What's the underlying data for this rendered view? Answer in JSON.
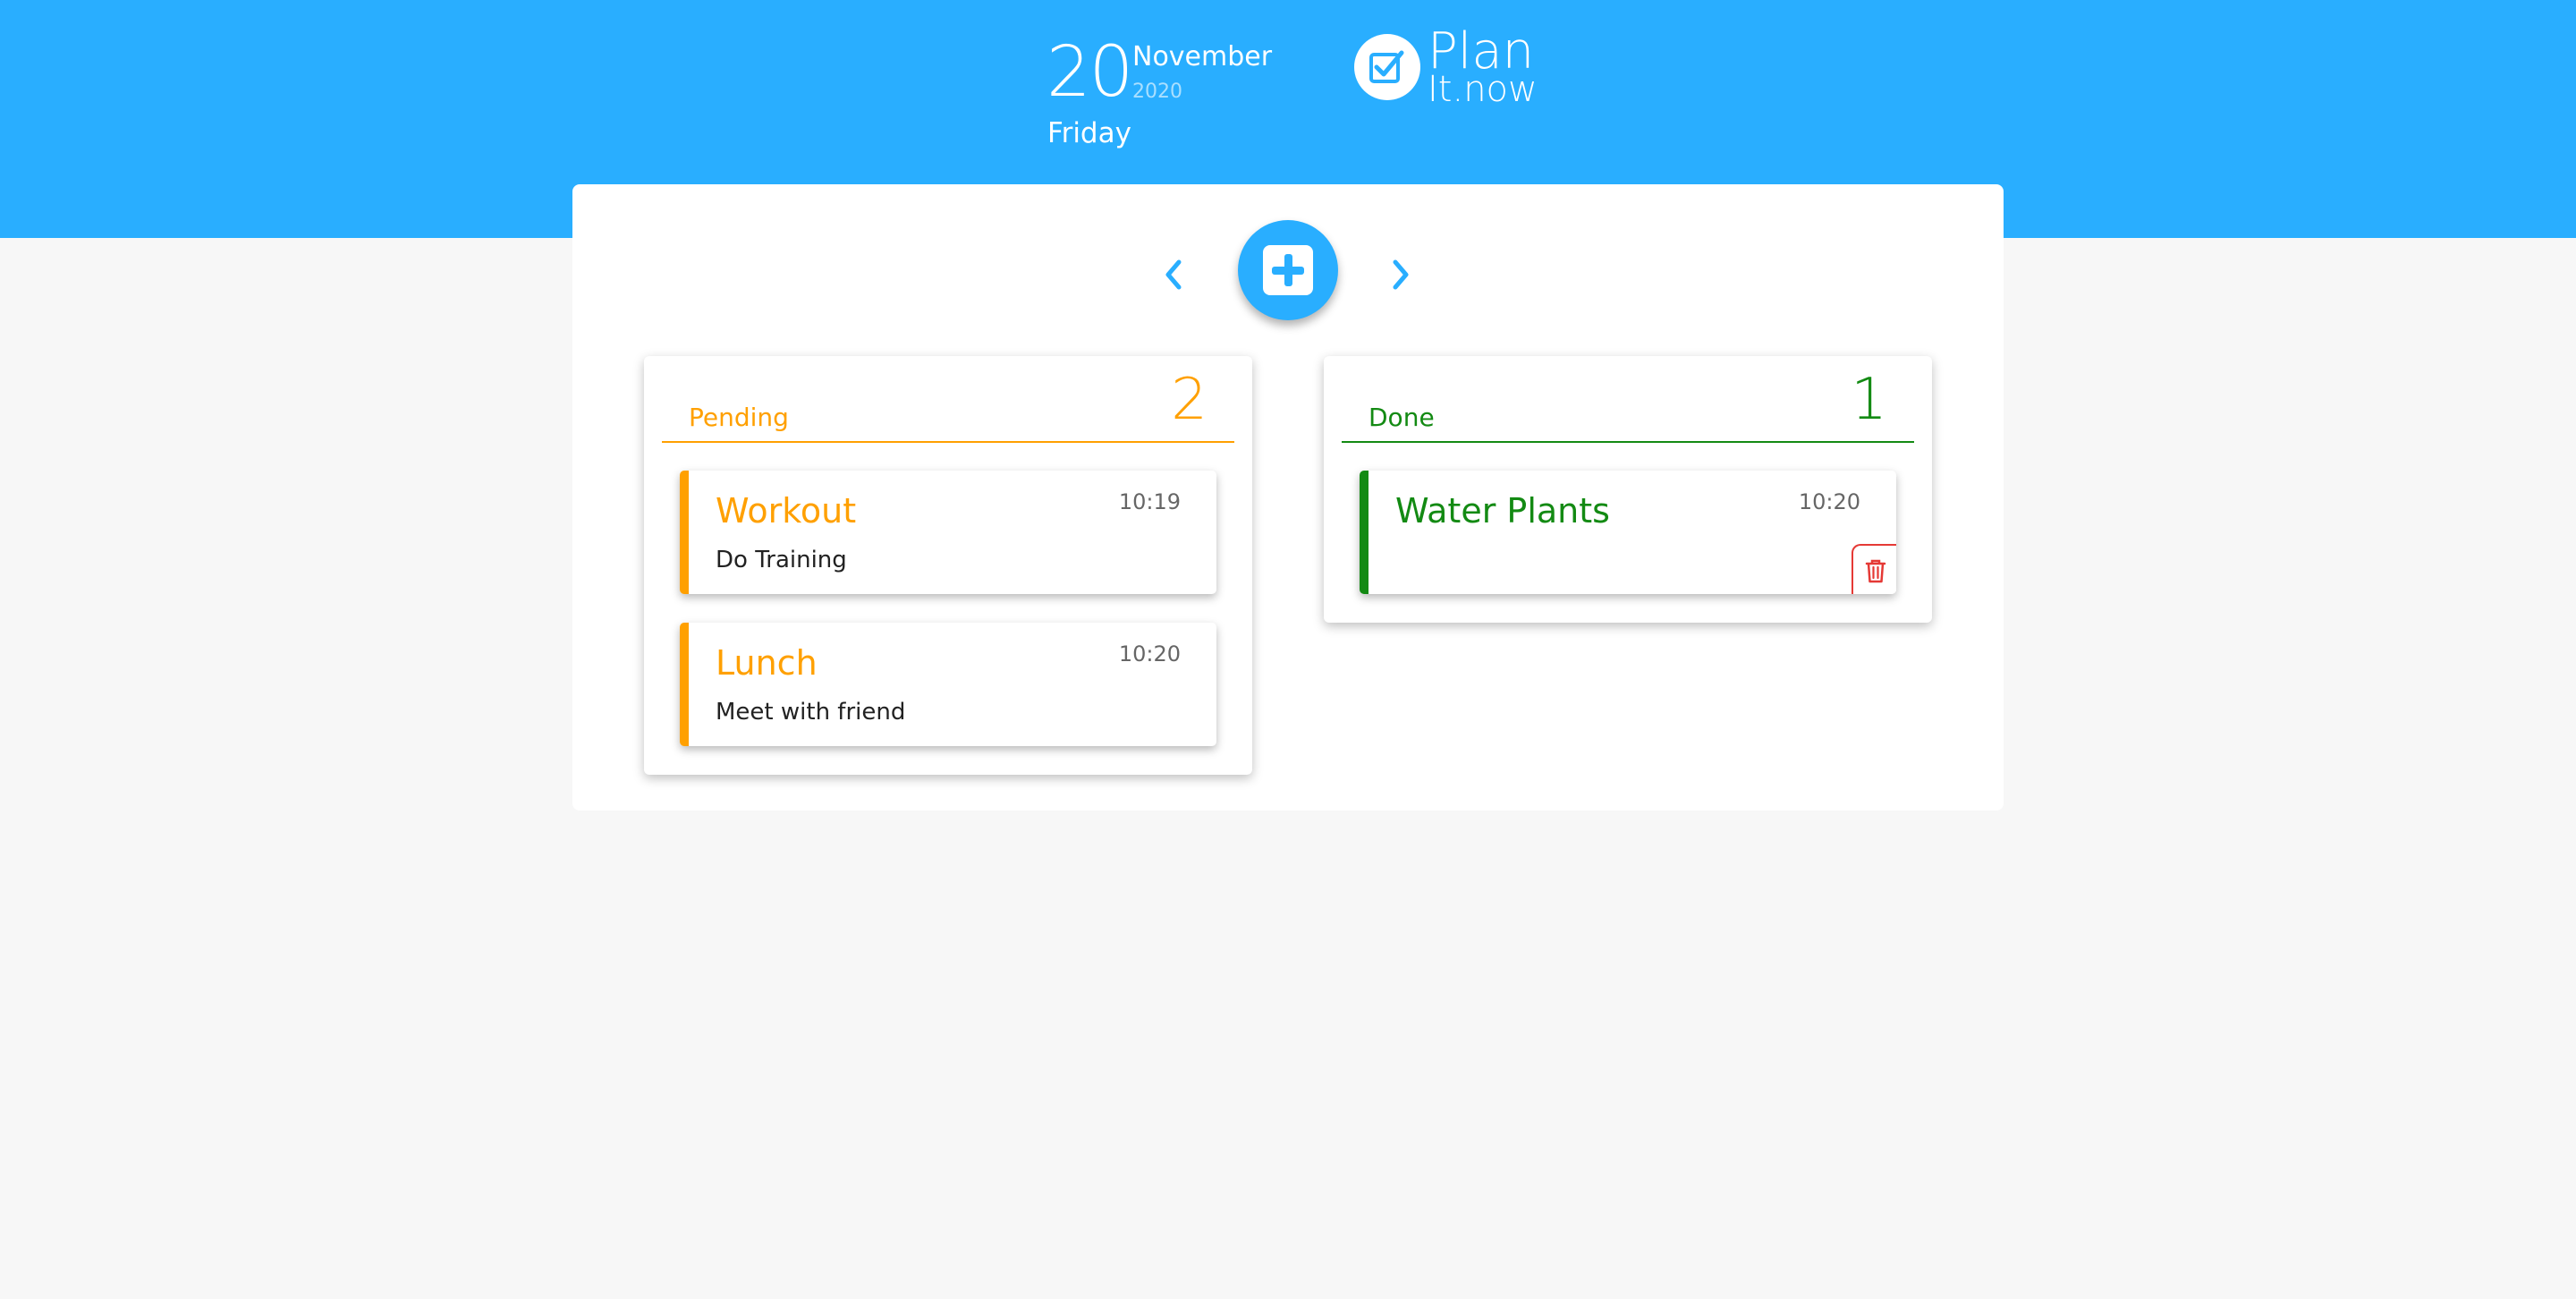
{
  "header": {
    "day": "20",
    "month": "November",
    "year": "2020",
    "weekday": "Friday",
    "logo_line1": "Plan",
    "logo_line2": "It.now",
    "logo_icon": "checkbox-icon",
    "brand_color": "#29aeff"
  },
  "nav": {
    "prev_icon": "chevron-left-icon",
    "next_icon": "chevron-right-icon",
    "add_icon": "plus-square-icon"
  },
  "columns": [
    {
      "label": "Pending",
      "count": "2",
      "color": "#ffa000",
      "tasks": [
        {
          "title": "Workout",
          "time": "10:19",
          "description": "Do Training"
        },
        {
          "title": "Lunch",
          "time": "10:20",
          "description": "Meet with friend"
        }
      ]
    },
    {
      "label": "Done",
      "count": "1",
      "color": "#138a13",
      "tasks": [
        {
          "title": "Water Plants",
          "time": "10:20",
          "description": "",
          "delete_icon": "trash-icon",
          "delete_color": "#e53935"
        }
      ]
    }
  ]
}
